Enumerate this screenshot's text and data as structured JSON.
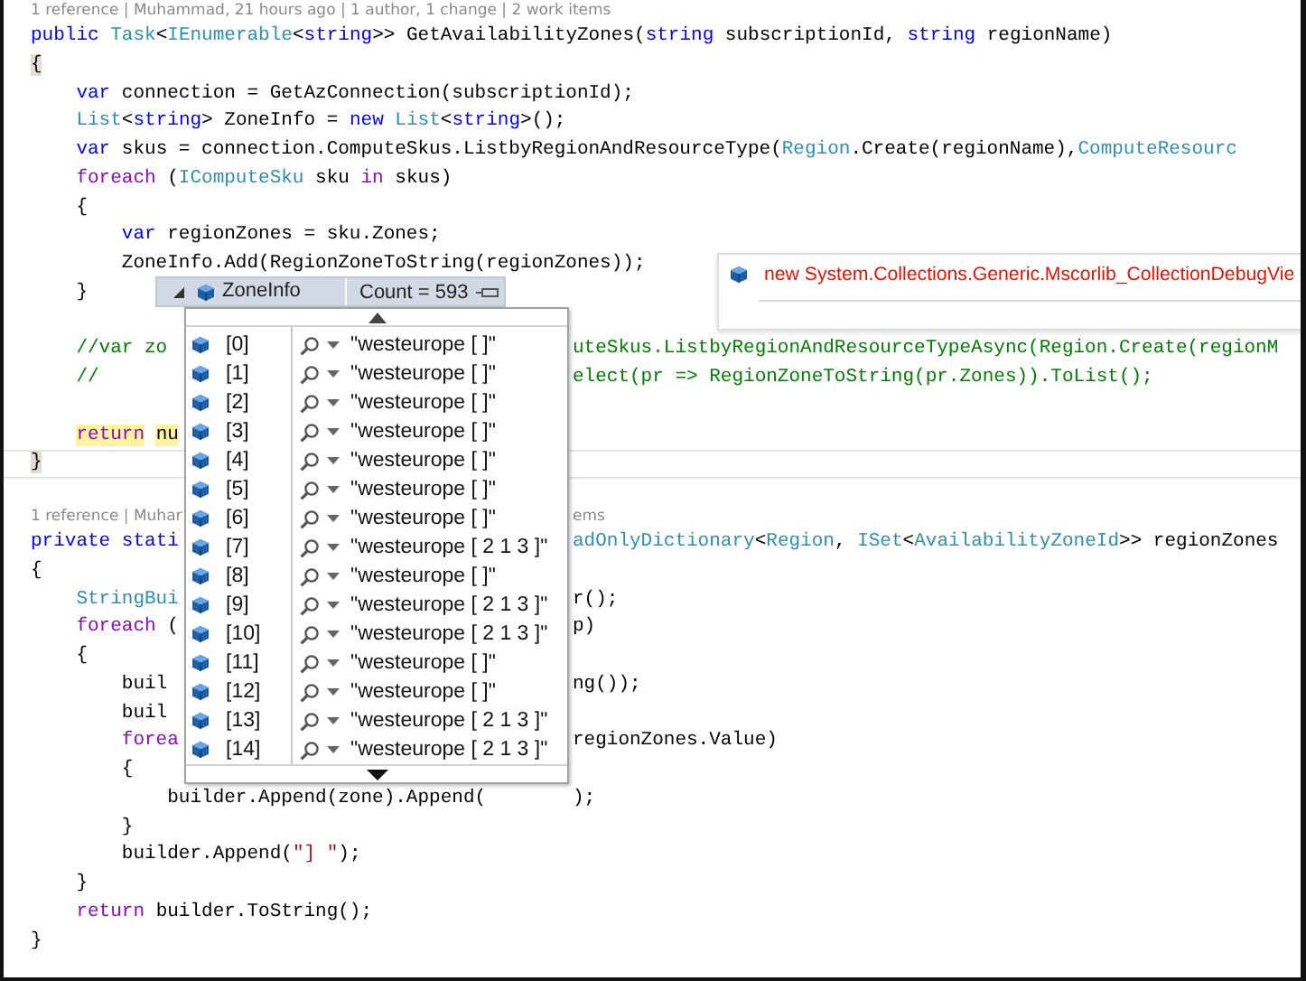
{
  "methods": [
    {
      "lines": [
        {
          "kind": "codelens",
          "tokens": [
            {
              "text": "1 reference | Muhammad, 21 hours ago | 1 author, 1 change | 2 work items",
              "kind": "lens"
            }
          ]
        },
        {
          "kind": "code",
          "current": false,
          "tokens": [
            {
              "text": "public",
              "kind": "kw"
            },
            {
              "text": " Task",
              "kind": "type"
            },
            {
              "text": "<",
              "kind": "plain"
            },
            {
              "text": "IEnumerable",
              "kind": "type"
            },
            {
              "text": "<",
              "kind": "plain"
            },
            {
              "text": "string",
              "kind": "kw"
            },
            {
              "text": ">> GetAvailabilityZones(",
              "kind": "plain"
            },
            {
              "text": "string",
              "kind": "kw"
            },
            {
              "text": " subscriptionId, ",
              "kind": "plain"
            },
            {
              "text": "string",
              "kind": "kw"
            },
            {
              "text": " regionName)",
              "kind": "plain"
            }
          ]
        },
        {
          "kind": "code",
          "current": false,
          "tokens": [
            {
              "text": "{",
              "kind": "brace",
              "highlighted": true
            }
          ]
        },
        {
          "kind": "code",
          "current": false,
          "tokens": [
            {
              "text": "    var",
              "kind": "kw"
            },
            {
              "text": " connection = GetAzConnection(subscriptionId);",
              "kind": "plain"
            }
          ]
        },
        {
          "kind": "code",
          "current": false,
          "tokens": [
            {
              "text": "    List",
              "kind": "type"
            },
            {
              "text": "<",
              "kind": "plain"
            },
            {
              "text": "string",
              "kind": "kw"
            },
            {
              "text": "> ZoneInfo = ",
              "kind": "plain"
            },
            {
              "text": "new",
              "kind": "kw"
            },
            {
              "text": " List",
              "kind": "type"
            },
            {
              "text": "<",
              "kind": "plain"
            },
            {
              "text": "string",
              "kind": "kw"
            },
            {
              "text": ">();",
              "kind": "plain"
            }
          ]
        },
        {
          "kind": "code",
          "current": false,
          "tokens": [
            {
              "text": "    var",
              "kind": "kw"
            },
            {
              "text": " skus = connection.ComputeSkus.ListbyRegionAndResourceType(",
              "kind": "plain"
            },
            {
              "text": "Region",
              "kind": "type"
            },
            {
              "text": ".Create(regionName),",
              "kind": "plain"
            },
            {
              "text": "ComputeResourc",
              "kind": "type"
            }
          ]
        },
        {
          "kind": "code",
          "current": false,
          "tokens": [
            {
              "text": "    foreach",
              "kind": "ctl"
            },
            {
              "text": " (",
              "kind": "plain"
            },
            {
              "text": "IComputeSku",
              "kind": "type"
            },
            {
              "text": " sku ",
              "kind": "plain"
            },
            {
              "text": "in",
              "kind": "ctl"
            },
            {
              "text": " skus)",
              "kind": "plain"
            }
          ]
        },
        {
          "kind": "code",
          "current": false,
          "tokens": [
            {
              "text": "    {",
              "kind": "brace",
              "highlighted": false
            }
          ]
        },
        {
          "kind": "code",
          "current": false,
          "tokens": [
            {
              "text": "        var",
              "kind": "kw"
            },
            {
              "text": " regionZones = sku.Zones;",
              "kind": "plain"
            }
          ]
        },
        {
          "kind": "code",
          "current": false,
          "tokens": [
            {
              "text": "        ZoneInfo.Add(RegionZoneToString(regionZones));",
              "kind": "plain"
            }
          ]
        },
        {
          "kind": "code",
          "current": false,
          "tokens": [
            {
              "text": "    }",
              "kind": "brace",
              "highlighted": false
            }
          ]
        },
        {
          "kind": "blank"
        },
        {
          "kind": "code",
          "current": false,
          "tokens": [
            {
              "text": "    //var zo",
              "kind": "comment"
            }
          ],
          "tokens_after_popup": [
            {
              "text": "uteSkus.ListbyRegionAndResourceTypeAsync(Region.Create(regionM",
              "kind": "comment"
            }
          ]
        },
        {
          "kind": "code",
          "current": false,
          "tokens": [
            {
              "text": "    //",
              "kind": "comment"
            }
          ],
          "tokens_after_popup": [
            {
              "text": "elect(pr => RegionZoneToString(pr.Zones)).ToList();",
              "kind": "comment"
            }
          ]
        },
        {
          "kind": "blank"
        },
        {
          "kind": "code",
          "current": false,
          "tokens": [
            {
              "text": "    return",
              "kind": "ctl",
              "highlighted": true
            },
            {
              "text": " nu",
              "kind": "plain",
              "highlighted": true
            }
          ]
        },
        {
          "kind": "code",
          "current": true,
          "tokens": [
            {
              "text": "}",
              "kind": "brace",
              "highlighted": true
            }
          ]
        }
      ]
    },
    {
      "lines": [
        {
          "kind": "codelens",
          "tokens": [
            {
              "text": "1 reference | Muhar",
              "kind": "lens"
            }
          ],
          "tokens_after_popup": [
            {
              "text": "ems",
              "kind": "lens"
            }
          ]
        },
        {
          "kind": "code",
          "current": false,
          "tokens": [
            {
              "text": "private",
              "kind": "kw"
            },
            {
              "text": " stati",
              "kind": "kw"
            }
          ],
          "tokens_after_popup": [
            {
              "text": "adOnlyDictionary",
              "kind": "type"
            },
            {
              "text": "<",
              "kind": "plain"
            },
            {
              "text": "Region",
              "kind": "type"
            },
            {
              "text": ", ",
              "kind": "plain"
            },
            {
              "text": "ISet",
              "kind": "type"
            },
            {
              "text": "<",
              "kind": "plain"
            },
            {
              "text": "AvailabilityZoneId",
              "kind": "type"
            },
            {
              "text": ">> regionZones",
              "kind": "plain"
            }
          ]
        },
        {
          "kind": "code",
          "current": false,
          "tokens": [
            {
              "text": "{",
              "kind": "brace",
              "highlighted": false
            }
          ]
        },
        {
          "kind": "code",
          "current": false,
          "tokens": [
            {
              "text": "    StringBui",
              "kind": "type"
            }
          ],
          "tokens_after_popup": [
            {
              "text": "r();",
              "kind": "plain"
            }
          ]
        },
        {
          "kind": "code",
          "current": false,
          "tokens": [
            {
              "text": "    foreach",
              "kind": "ctl"
            },
            {
              "text": " (",
              "kind": "plain"
            }
          ],
          "tokens_after_popup": [
            {
              "text": "p)",
              "kind": "plain"
            }
          ]
        },
        {
          "kind": "code",
          "current": false,
          "tokens": [
            {
              "text": "    {",
              "kind": "brace",
              "highlighted": false
            }
          ]
        },
        {
          "kind": "code",
          "current": false,
          "tokens": [
            {
              "text": "        buil",
              "kind": "plain"
            }
          ],
          "tokens_after_popup": [
            {
              "text": "ng());",
              "kind": "plain"
            }
          ]
        },
        {
          "kind": "code",
          "current": false,
          "tokens": [
            {
              "text": "        buil",
              "kind": "plain"
            }
          ]
        },
        {
          "kind": "code",
          "current": false,
          "tokens": [
            {
              "text": "        forea",
              "kind": "ctl"
            }
          ],
          "tokens_after_popup": [
            {
              "text": "regionZones.Value)",
              "kind": "plain"
            }
          ]
        },
        {
          "kind": "code",
          "current": false,
          "tokens": [
            {
              "text": "        {",
              "kind": "brace",
              "highlighted": false
            }
          ]
        },
        {
          "kind": "code",
          "current": false,
          "tokens": [
            {
              "text": "            builder.Append(zone).Append(",
              "kind": "plain"
            }
          ],
          "tokens_after_popup": [
            {
              "text": ");",
              "kind": "plain"
            }
          ]
        },
        {
          "kind": "code",
          "current": false,
          "tokens": [
            {
              "text": "        }",
              "kind": "brace",
              "highlighted": false
            }
          ]
        },
        {
          "kind": "code",
          "current": false,
          "tokens": [
            {
              "text": "        builder.Append(",
              "kind": "plain"
            },
            {
              "text": "\"] \"",
              "kind": "str"
            },
            {
              "text": ");",
              "kind": "plain"
            }
          ]
        },
        {
          "kind": "code",
          "current": false,
          "tokens": [
            {
              "text": "    }",
              "kind": "brace",
              "highlighted": false
            }
          ]
        },
        {
          "kind": "code",
          "current": false,
          "tokens": [
            {
              "text": "    return",
              "kind": "ctl"
            },
            {
              "text": " builder.ToString();",
              "kind": "plain"
            }
          ]
        },
        {
          "kind": "code",
          "current": false,
          "tokens": [
            {
              "text": "}",
              "kind": "brace",
              "highlighted": false
            }
          ]
        }
      ]
    }
  ],
  "datatip": {
    "name": "ZoneInfo",
    "count": "Count = 593",
    "expanded": true,
    "items": [
      {
        "index": "[0]",
        "value": "\"westeurope [ ]\""
      },
      {
        "index": "[1]",
        "value": "\"westeurope [ ]\""
      },
      {
        "index": "[2]",
        "value": "\"westeurope [ ]\""
      },
      {
        "index": "[3]",
        "value": "\"westeurope [ ]\""
      },
      {
        "index": "[4]",
        "value": "\"westeurope [ ]\""
      },
      {
        "index": "[5]",
        "value": "\"westeurope [ ]\""
      },
      {
        "index": "[6]",
        "value": "\"westeurope [ ]\""
      },
      {
        "index": "[7]",
        "value": "\"westeurope [ 2 1 3 ]\""
      },
      {
        "index": "[8]",
        "value": "\"westeurope [ ]\""
      },
      {
        "index": "[9]",
        "value": "\"westeurope [ 2 1 3 ]\""
      },
      {
        "index": "[10]",
        "value": "\"westeurope [ 2 1 3 ]\""
      },
      {
        "index": "[11]",
        "value": "\"westeurope [ ]\""
      },
      {
        "index": "[12]",
        "value": "\"westeurope [ ]\""
      },
      {
        "index": "[13]",
        "value": "\"westeurope [ 2 1 3 ]\""
      },
      {
        "index": "[14]",
        "value": "\"westeurope [ 2 1 3 ]\""
      }
    ]
  },
  "tooltip": {
    "text": "new System.Collections.Generic.Mscorlib_CollectionDebugVie"
  }
}
